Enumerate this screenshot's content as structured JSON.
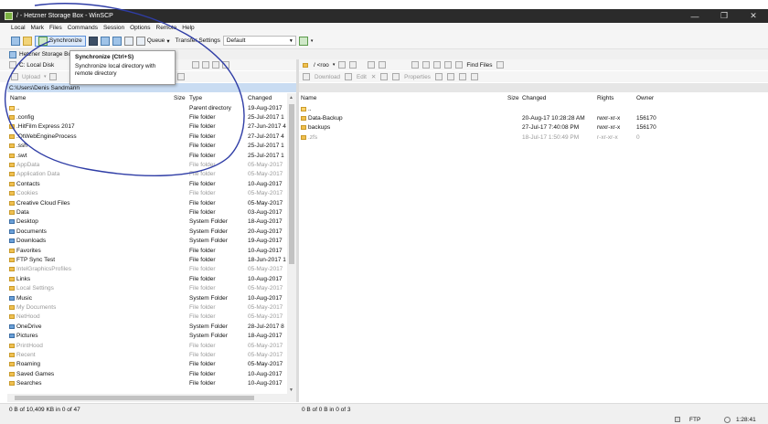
{
  "window": {
    "title": "/ - Hetzner Storage Box - WinSCP",
    "min": "—",
    "max": "❐",
    "close": "✕"
  },
  "menu": [
    "Local",
    "Mark",
    "Files",
    "Commands",
    "Session",
    "Options",
    "Remote",
    "Help"
  ],
  "toolbar": {
    "synchronize": "Synchronize",
    "queue": "Queue",
    "transfer_label": "Transfer Settings",
    "transfer_value": "Default"
  },
  "session_tab": "Hetzner Storage Bo...",
  "tooltip": {
    "title": "Synchronize (Ctrl+S)",
    "desc": "Synchronize local directory with remote directory"
  },
  "left": {
    "drive": "C: Local Disk",
    "upload": "Upload",
    "path": "C:\\Users\\Denis Sandmann",
    "headers": {
      "name": "Name",
      "size": "Size",
      "type": "Type",
      "changed": "Changed"
    },
    "rows": [
      {
        "name": "..",
        "type": "Parent directory",
        "changed": "19-Aug-2017",
        "icon": "up",
        "hidden": false
      },
      {
        "name": ".config",
        "type": "File folder",
        "changed": "25-Jul-2017 1",
        "icon": "folder",
        "hidden": false
      },
      {
        "name": ".HitFilm Express 2017",
        "type": "File folder",
        "changed": "27-Jun-2017 4",
        "icon": "folder",
        "hidden": false
      },
      {
        "name": ".QtWebEngineProcess",
        "type": "File folder",
        "changed": "27-Jul-2017 4",
        "icon": "folder",
        "hidden": false
      },
      {
        "name": ".ssh",
        "type": "File folder",
        "changed": "25-Jul-2017 1",
        "icon": "folder",
        "hidden": false
      },
      {
        "name": ".swt",
        "type": "File folder",
        "changed": "25-Jul-2017 1",
        "icon": "folder",
        "hidden": false
      },
      {
        "name": "AppData",
        "type": "File folder",
        "changed": "05-May-2017",
        "icon": "folder",
        "hidden": true
      },
      {
        "name": "Application Data",
        "type": "File folder",
        "changed": "05-May-2017",
        "icon": "folder",
        "hidden": true
      },
      {
        "name": "Contacts",
        "type": "File folder",
        "changed": "10-Aug-2017",
        "icon": "folder",
        "hidden": false
      },
      {
        "name": "Cookies",
        "type": "File folder",
        "changed": "05-May-2017",
        "icon": "folder",
        "hidden": true
      },
      {
        "name": "Creative Cloud Files",
        "type": "File folder",
        "changed": "05-May-2017",
        "icon": "folder",
        "hidden": false
      },
      {
        "name": "Data",
        "type": "File folder",
        "changed": "03-Aug-2017",
        "icon": "folder",
        "hidden": false
      },
      {
        "name": "Desktop",
        "type": "System Folder",
        "changed": "18-Aug-2017",
        "icon": "sys",
        "hidden": false
      },
      {
        "name": "Documents",
        "type": "System Folder",
        "changed": "20-Aug-2017",
        "icon": "sys",
        "hidden": false
      },
      {
        "name": "Downloads",
        "type": "System Folder",
        "changed": "19-Aug-2017",
        "icon": "sys",
        "hidden": false
      },
      {
        "name": "Favorites",
        "type": "File folder",
        "changed": "10-Aug-2017",
        "icon": "folder",
        "hidden": false
      },
      {
        "name": "FTP Sync Test",
        "type": "File folder",
        "changed": "18-Jun-2017 1",
        "icon": "folder",
        "hidden": false
      },
      {
        "name": "IntelGraphicsProfiles",
        "type": "File folder",
        "changed": "05-May-2017",
        "icon": "folder",
        "hidden": true
      },
      {
        "name": "Links",
        "type": "File folder",
        "changed": "10-Aug-2017",
        "icon": "folder",
        "hidden": false
      },
      {
        "name": "Local Settings",
        "type": "File folder",
        "changed": "05-May-2017",
        "icon": "folder",
        "hidden": true
      },
      {
        "name": "Music",
        "type": "System Folder",
        "changed": "10-Aug-2017",
        "icon": "sys",
        "hidden": false
      },
      {
        "name": "My Documents",
        "type": "File folder",
        "changed": "05-May-2017",
        "icon": "folder",
        "hidden": true
      },
      {
        "name": "NetHood",
        "type": "File folder",
        "changed": "05-May-2017",
        "icon": "folder",
        "hidden": true
      },
      {
        "name": "OneDrive",
        "type": "System Folder",
        "changed": "28-Jul-2017 8",
        "icon": "sys",
        "hidden": false
      },
      {
        "name": "Pictures",
        "type": "System Folder",
        "changed": "18-Aug-2017",
        "icon": "sys",
        "hidden": false
      },
      {
        "name": "PrintHood",
        "type": "File folder",
        "changed": "05-May-2017",
        "icon": "folder",
        "hidden": true
      },
      {
        "name": "Recent",
        "type": "File folder",
        "changed": "05-May-2017",
        "icon": "folder",
        "hidden": true
      },
      {
        "name": "Roaming",
        "type": "File folder",
        "changed": "05-May-2017",
        "icon": "folder",
        "hidden": false
      },
      {
        "name": "Saved Games",
        "type": "File folder",
        "changed": "10-Aug-2017",
        "icon": "folder",
        "hidden": false
      },
      {
        "name": "Searches",
        "type": "File folder",
        "changed": "10-Aug-2017",
        "icon": "folder",
        "hidden": false
      }
    ]
  },
  "right": {
    "path_label": "/ <roo",
    "find_files": "Find Files",
    "download": "Download",
    "edit": "Edit",
    "properties": "Properties",
    "headers": {
      "name": "Name",
      "size": "Size",
      "changed": "Changed",
      "rights": "Rights",
      "owner": "Owner"
    },
    "rows": [
      {
        "name": "..",
        "changed": "",
        "rights": "",
        "owner": "",
        "icon": "up",
        "hidden": false
      },
      {
        "name": "Data-Backup",
        "changed": "20-Aug-17 10:28:28 AM",
        "rights": "rwxr-xr-x",
        "owner": "156170",
        "icon": "folder",
        "hidden": false
      },
      {
        "name": "backups",
        "changed": "27-Jul-17 7:40:08 PM",
        "rights": "rwxr-xr-x",
        "owner": "156170",
        "icon": "folder",
        "hidden": false
      },
      {
        "name": ".zfs",
        "changed": "18-Jul-17 1:50:49 PM",
        "rights": "r-xr-xr-x",
        "owner": "0",
        "icon": "folder",
        "hidden": true
      }
    ]
  },
  "status": {
    "left": "0 B of 10,409 KB in 0 of 47",
    "right": "0 B of 0 B in 0 of 3",
    "protocol": "FTP",
    "time": "1:28:41"
  }
}
